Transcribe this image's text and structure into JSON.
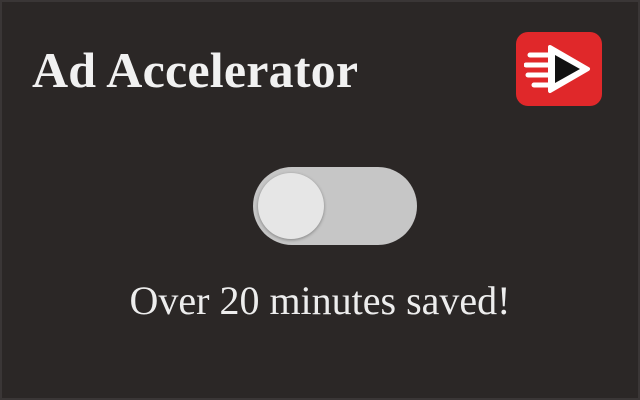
{
  "header": {
    "title": "Ad Accelerator",
    "logo_icon": "fast-forward-arrow-icon",
    "logo_color": "#e0282a"
  },
  "toggle": {
    "state": "off",
    "track_color": "#c6c6c6",
    "knob_color": "#e6e6e6"
  },
  "status": {
    "message": "Over 20 minutes saved!"
  },
  "colors": {
    "background": "#2b2726",
    "text": "#f1f1f1"
  }
}
